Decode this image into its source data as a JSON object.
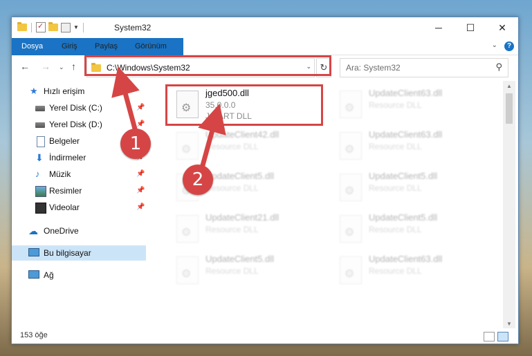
{
  "window": {
    "title": "System32"
  },
  "ribbon": {
    "tabs": [
      "Dosya",
      "Giriş",
      "Paylaş",
      "Görünüm"
    ]
  },
  "address": {
    "path": "C:\\Windows\\System32"
  },
  "search": {
    "placeholder": "Ara: System32"
  },
  "nav_pane": {
    "items": [
      {
        "label": "Hızlı erişim",
        "icon": "star-icon"
      },
      {
        "label": "Yerel Disk (C:)",
        "icon": "disk-icon",
        "pinned": true
      },
      {
        "label": "Yerel Disk (D:)",
        "icon": "disk-icon",
        "pinned": true
      },
      {
        "label": "Belgeler",
        "icon": "document-icon",
        "pinned": true
      },
      {
        "label": "İndirmeler",
        "icon": "download-icon",
        "pinned": true
      },
      {
        "label": "Müzik",
        "icon": "music-icon",
        "pinned": true
      },
      {
        "label": "Resimler",
        "icon": "picture-icon",
        "pinned": true
      },
      {
        "label": "Videolar",
        "icon": "video-icon",
        "pinned": true
      },
      {
        "label": "OneDrive",
        "icon": "cloud-icon"
      },
      {
        "label": "Bu bilgisayar",
        "icon": "computer-icon",
        "selected": true
      },
      {
        "label": "Ağ",
        "icon": "network-icon"
      }
    ]
  },
  "files": [
    {
      "name": "jged500.dll",
      "line1": "35.0.0.0",
      "line2": "JG ART DLL",
      "highlighted": true
    },
    {
      "name": "UpdateClient63.dll",
      "line1": "Resource DLL"
    },
    {
      "name": "UpdateClient42.dll",
      "line1": "Resource DLL"
    },
    {
      "name": "UpdateClient63.dll",
      "line1": "Resource DLL"
    },
    {
      "name": "UpdateClient5.dll",
      "line1": "Resource DLL"
    },
    {
      "name": "UpdateClient5.dll",
      "line1": "Resource DLL"
    },
    {
      "name": "UpdateClient21.dll",
      "line1": "Resource DLL"
    },
    {
      "name": "UpdateClient5.dll",
      "line1": "Resource DLL"
    },
    {
      "name": "UpdateClient5.dll",
      "line1": "Resource DLL"
    },
    {
      "name": "UpdateClient63.dll",
      "line1": "Resource DLL"
    }
  ],
  "status": {
    "count": "153 öğe"
  },
  "annotations": {
    "badge1": "1",
    "badge2": "2"
  },
  "colors": {
    "accent": "#1a73c4",
    "highlight": "#d64545",
    "selected_bg": "#cce4f7"
  }
}
